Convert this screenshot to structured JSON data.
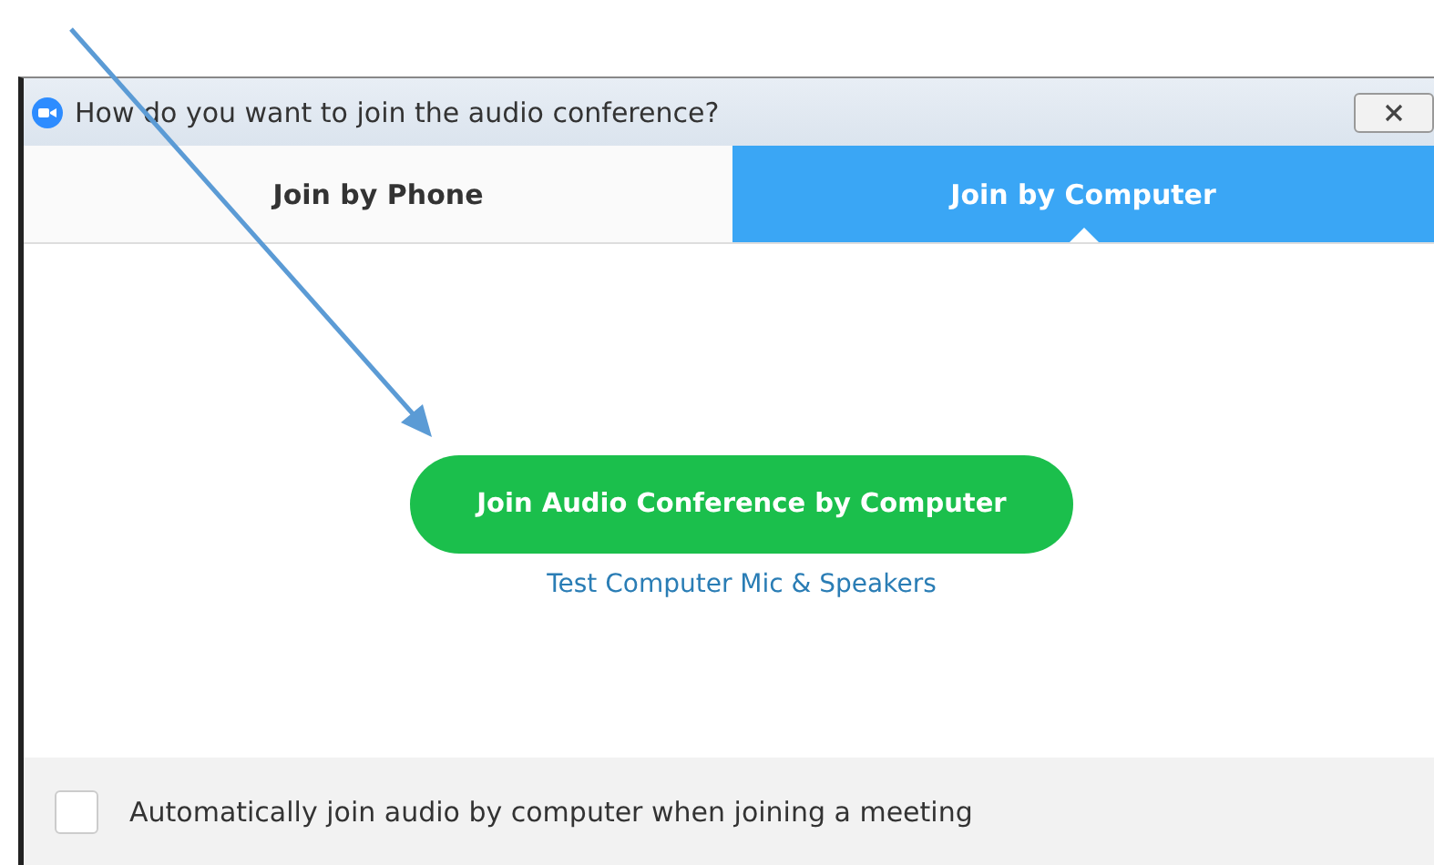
{
  "window": {
    "title": "How do you want to join the audio conference?"
  },
  "tabs": [
    {
      "label": "Join by Phone",
      "selected": false
    },
    {
      "label": "Join by Computer",
      "selected": true
    }
  ],
  "join_button": "Join Audio Conference by Computer",
  "test_link": "Test Computer Mic & Speakers",
  "auto_join": {
    "label": "Automatically join audio by computer when joining a meeting",
    "checked": false
  }
}
